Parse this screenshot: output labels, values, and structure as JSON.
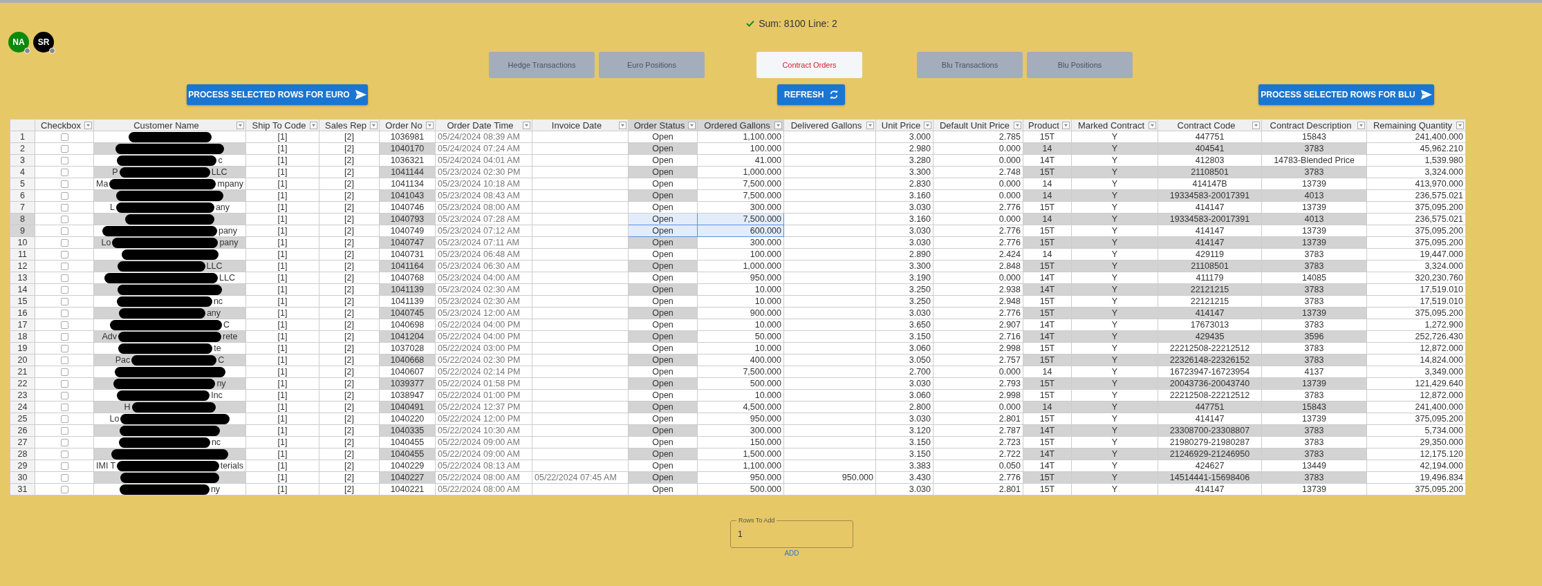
{
  "summary": {
    "text": "Sum: 8100 Line: 2"
  },
  "avatars": [
    {
      "initials": "NA",
      "color": "#0b8a0b"
    },
    {
      "initials": "SR",
      "color": "#000000"
    }
  ],
  "tabs": [
    {
      "label": "Hedge Transactions",
      "selected": false
    },
    {
      "label": "Euro Positions",
      "selected": false
    },
    {
      "label": "Contract Orders",
      "selected": true
    },
    {
      "label": "Blu Transactions",
      "selected": false
    },
    {
      "label": "Blu Positions",
      "selected": false
    }
  ],
  "buttons": [
    {
      "label": "PROCESS SELECTED ROWS FOR EURO",
      "kind": "send"
    },
    {
      "label": "REFRESH",
      "kind": "refresh"
    },
    {
      "label": "PROCESS SELECTED ROWS FOR BLU",
      "kind": "send"
    }
  ],
  "table": {
    "columns": [
      "Checkbox",
      "Customer Name",
      "Ship To Code",
      "Sales Rep",
      "Order No",
      "Order Date Time",
      "Invoice Date",
      "Order Status",
      "Ordered Gallons",
      "Delivered Gallons",
      "Unit Price",
      "Default Unit Price",
      "Product",
      "Marked Contract",
      "Contract Code",
      "Contract Description",
      "Remaining Quantity"
    ],
    "rows": [
      {
        "n": "1",
        "checked": false,
        "selected": false,
        "ship_to_code": "[1]",
        "sales_rep": "[2]",
        "order_no": "1036981",
        "order_date_time": "05/24/2024 08:39 AM",
        "order_status": "Open",
        "ordered_gallons": "1,100.000",
        "unit_price": "3.000",
        "default_unit_price": "2.785",
        "product": "15T",
        "marked_contract": "Y",
        "contract_code": "447751",
        "contract_description": "15843",
        "remaining_quantity": "241,400.000"
      },
      {
        "n": "2",
        "checked": false,
        "selected": false,
        "ship_to_code": "[1]",
        "sales_rep": "[2]",
        "order_no": "1040170",
        "order_date_time": "05/24/2024 07:24 AM",
        "order_status": "Open",
        "ordered_gallons": "100.000",
        "unit_price": "2.980",
        "default_unit_price": "0.000",
        "product": "14",
        "marked_contract": "Y",
        "contract_code": "404541",
        "contract_description": "3783",
        "remaining_quantity": "45,962.210"
      },
      {
        "n": "3",
        "checked": false,
        "selected": false,
        "customer_end": "c",
        "ship_to_code": "[1]",
        "sales_rep": "[2]",
        "order_no": "1036321",
        "order_date_time": "05/24/2024 04:01 AM",
        "order_status": "Open",
        "ordered_gallons": "41.000",
        "unit_price": "3.280",
        "default_unit_price": "0.000",
        "product": "14T",
        "marked_contract": "Y",
        "contract_code": "412803",
        "contract_description": "14783-Blended Price",
        "remaining_quantity": "1,539.980"
      },
      {
        "n": "4",
        "checked": false,
        "selected": false,
        "customer_start": "P",
        "customer_end": "LLC",
        "ship_to_code": "[1]",
        "sales_rep": "[2]",
        "order_no": "1041144",
        "order_date_time": "05/23/2024 02:30 PM",
        "order_status": "Open",
        "ordered_gallons": "1,000.000",
        "unit_price": "3.300",
        "default_unit_price": "2.748",
        "product": "15T",
        "marked_contract": "Y",
        "contract_code": "21108501",
        "contract_description": "3783",
        "remaining_quantity": "3,324.000"
      },
      {
        "n": "5",
        "checked": false,
        "selected": false,
        "customer_start": "Ma",
        "customer_end": "mpany",
        "ship_to_code": "[1]",
        "sales_rep": "[2]",
        "order_no": "1041134",
        "order_date_time": "05/23/2024 10:18 AM",
        "order_status": "Open",
        "ordered_gallons": "7,500.000",
        "unit_price": "2.830",
        "default_unit_price": "0.000",
        "product": "14",
        "marked_contract": "Y",
        "contract_code": "414147B",
        "contract_description": "13739",
        "remaining_quantity": "413,970.000"
      },
      {
        "n": "6",
        "checked": false,
        "selected": false,
        "ship_to_code": "[1]",
        "sales_rep": "[2]",
        "order_no": "1041043",
        "order_date_time": "05/23/2024 08:43 AM",
        "order_status": "Open",
        "ordered_gallons": "7,500.000",
        "unit_price": "3.160",
        "default_unit_price": "0.000",
        "product": "14",
        "marked_contract": "Y",
        "contract_code": "19334583-20017391",
        "contract_description": "4013",
        "remaining_quantity": "236,575.021"
      },
      {
        "n": "7",
        "checked": false,
        "selected": false,
        "customer_start": "L",
        "customer_end": "any",
        "ship_to_code": "[1]",
        "sales_rep": "[2]",
        "order_no": "1040746",
        "order_date_time": "05/23/2024 08:00 AM",
        "order_status": "Open",
        "ordered_gallons": "300.000",
        "unit_price": "3.030",
        "default_unit_price": "2.776",
        "product": "15T",
        "marked_contract": "Y",
        "contract_code": "414147",
        "contract_description": "13739",
        "remaining_quantity": "375,095.200"
      },
      {
        "n": "8",
        "checked": false,
        "selected": true,
        "ship_to_code": "[1]",
        "sales_rep": "[2]",
        "order_no": "1040793",
        "order_date_time": "05/23/2024 07:28 AM",
        "order_status": "Open",
        "ordered_gallons": "7,500.000",
        "unit_price": "3.160",
        "default_unit_price": "0.000",
        "product": "14",
        "marked_contract": "Y",
        "contract_code": "19334583-20017391",
        "contract_description": "4013",
        "remaining_quantity": "236,575.021"
      },
      {
        "n": "9",
        "checked": false,
        "selected": true,
        "customer_end": "pany",
        "ship_to_code": "[1]",
        "sales_rep": "[2]",
        "order_no": "1040749",
        "order_date_time": "05/23/2024 07:12 AM",
        "order_status": "Open",
        "ordered_gallons": "600.000",
        "unit_price": "3.030",
        "default_unit_price": "2.776",
        "product": "15T",
        "marked_contract": "Y",
        "contract_code": "414147",
        "contract_description": "13739",
        "remaining_quantity": "375,095.200"
      },
      {
        "n": "10",
        "checked": false,
        "selected": false,
        "customer_start": "Lo",
        "customer_end": "pany",
        "ship_to_code": "[1]",
        "sales_rep": "[2]",
        "order_no": "1040747",
        "order_date_time": "05/23/2024 07:11 AM",
        "order_status": "Open",
        "ordered_gallons": "300.000",
        "unit_price": "3.030",
        "default_unit_price": "2.776",
        "product": "15T",
        "marked_contract": "Y",
        "contract_code": "414147",
        "contract_description": "13739",
        "remaining_quantity": "375,095.200"
      },
      {
        "n": "11",
        "checked": false,
        "selected": false,
        "ship_to_code": "[1]",
        "sales_rep": "[2]",
        "order_no": "1040731",
        "order_date_time": "05/23/2024 06:48 AM",
        "order_status": "Open",
        "ordered_gallons": "100.000",
        "unit_price": "2.890",
        "default_unit_price": "2.424",
        "product": "14",
        "marked_contract": "Y",
        "contract_code": "429119",
        "contract_description": "3783",
        "remaining_quantity": "19,447.000"
      },
      {
        "n": "12",
        "checked": false,
        "selected": false,
        "customer_end": "LLC",
        "ship_to_code": "[1]",
        "sales_rep": "[2]",
        "order_no": "1041164",
        "order_date_time": "05/23/2024 06:30 AM",
        "order_status": "Open",
        "ordered_gallons": "1,000.000",
        "unit_price": "3.300",
        "default_unit_price": "2.848",
        "product": "15T",
        "marked_contract": "Y",
        "contract_code": "21108501",
        "contract_description": "3783",
        "remaining_quantity": "3,324.000"
      },
      {
        "n": "13",
        "checked": false,
        "selected": false,
        "customer_end": "LLC",
        "ship_to_code": "[1]",
        "sales_rep": "[2]",
        "order_no": "1040768",
        "order_date_time": "05/23/2024 04:00 AM",
        "order_status": "Open",
        "ordered_gallons": "950.000",
        "unit_price": "3.190",
        "default_unit_price": "0.000",
        "product": "14T",
        "marked_contract": "Y",
        "contract_code": "411179",
        "contract_description": "14085",
        "remaining_quantity": "320,230.760"
      },
      {
        "n": "14",
        "checked": false,
        "selected": false,
        "ship_to_code": "[1]",
        "sales_rep": "[2]",
        "order_no": "1041139",
        "order_date_time": "05/23/2024 02:30 AM",
        "order_status": "Open",
        "ordered_gallons": "10.000",
        "unit_price": "3.250",
        "default_unit_price": "2.938",
        "product": "14T",
        "marked_contract": "Y",
        "contract_code": "22121215",
        "contract_description": "3783",
        "remaining_quantity": "17,519.010"
      },
      {
        "n": "15",
        "checked": false,
        "selected": false,
        "customer_end": "nc",
        "ship_to_code": "[1]",
        "sales_rep": "[2]",
        "order_no": "1041139",
        "order_date_time": "05/23/2024 02:30 AM",
        "order_status": "Open",
        "ordered_gallons": "10.000",
        "unit_price": "3.250",
        "default_unit_price": "2.948",
        "product": "15T",
        "marked_contract": "Y",
        "contract_code": "22121215",
        "contract_description": "3783",
        "remaining_quantity": "17,519.010"
      },
      {
        "n": "16",
        "checked": false,
        "selected": false,
        "customer_end": "any",
        "ship_to_code": "[1]",
        "sales_rep": "[2]",
        "order_no": "1040745",
        "order_date_time": "05/23/2024 12:00 AM",
        "order_status": "Open",
        "ordered_gallons": "900.000",
        "unit_price": "3.030",
        "default_unit_price": "2.776",
        "product": "15T",
        "marked_contract": "Y",
        "contract_code": "414147",
        "contract_description": "13739",
        "remaining_quantity": "375,095.200"
      },
      {
        "n": "17",
        "checked": false,
        "selected": false,
        "customer_end": "C",
        "ship_to_code": "[1]",
        "sales_rep": "[2]",
        "order_no": "1040698",
        "order_date_time": "05/22/2024 04:00 PM",
        "order_status": "Open",
        "ordered_gallons": "10.000",
        "unit_price": "3.650",
        "default_unit_price": "2.907",
        "product": "14T",
        "marked_contract": "Y",
        "contract_code": "17673013",
        "contract_description": "3783",
        "remaining_quantity": "1,272.900"
      },
      {
        "n": "18",
        "checked": false,
        "selected": false,
        "customer_start": "Adv",
        "customer_end": "rete",
        "ship_to_code": "[1]",
        "sales_rep": "[2]",
        "order_no": "1041204",
        "order_date_time": "05/22/2024 04:00 PM",
        "order_status": "Open",
        "ordered_gallons": "50.000",
        "unit_price": "3.150",
        "default_unit_price": "2.716",
        "product": "14T",
        "marked_contract": "Y",
        "contract_code": "429435",
        "contract_description": "3596",
        "remaining_quantity": "252,726.430"
      },
      {
        "n": "19",
        "checked": false,
        "selected": false,
        "customer_end": "te",
        "ship_to_code": "[1]",
        "sales_rep": "[2]",
        "order_no": "1037028",
        "order_date_time": "05/22/2024 03:00 PM",
        "order_status": "Open",
        "ordered_gallons": "10.000",
        "unit_price": "3.060",
        "default_unit_price": "2.998",
        "product": "15T",
        "marked_contract": "Y",
        "contract_code": "22212508-22212512",
        "contract_description": "3783",
        "remaining_quantity": "12,872.000"
      },
      {
        "n": "20",
        "checked": false,
        "selected": false,
        "customer_start": "Pac",
        "customer_end": "C",
        "ship_to_code": "[1]",
        "sales_rep": "[2]",
        "order_no": "1040668",
        "order_date_time": "05/22/2024 02:30 PM",
        "order_status": "Open",
        "ordered_gallons": "400.000",
        "unit_price": "3.050",
        "default_unit_price": "2.757",
        "product": "15T",
        "marked_contract": "Y",
        "contract_code": "22326148-22326152",
        "contract_description": "3783",
        "remaining_quantity": "14,824.000"
      },
      {
        "n": "21",
        "checked": false,
        "selected": false,
        "ship_to_code": "[1]",
        "sales_rep": "[2]",
        "order_no": "1040607",
        "order_date_time": "05/22/2024 02:14 PM",
        "order_status": "Open",
        "ordered_gallons": "7,500.000",
        "unit_price": "2.700",
        "default_unit_price": "0.000",
        "product": "14",
        "marked_contract": "Y",
        "contract_code": "16723947-16723954",
        "contract_description": "4137",
        "remaining_quantity": "3,349.000"
      },
      {
        "n": "22",
        "checked": false,
        "selected": false,
        "customer_end": "ny",
        "ship_to_code": "[1]",
        "sales_rep": "[2]",
        "order_no": "1039377",
        "order_date_time": "05/22/2024 01:58 PM",
        "order_status": "Open",
        "ordered_gallons": "500.000",
        "unit_price": "3.030",
        "default_unit_price": "2.793",
        "product": "15T",
        "marked_contract": "Y",
        "contract_code": "20043736-20043740",
        "contract_description": "13739",
        "remaining_quantity": "121,429.640"
      },
      {
        "n": "23",
        "checked": false,
        "selected": false,
        "customer_end": "Inc",
        "ship_to_code": "[1]",
        "sales_rep": "[2]",
        "order_no": "1038947",
        "order_date_time": "05/22/2024 01:00 PM",
        "order_status": "Open",
        "ordered_gallons": "10.000",
        "unit_price": "3.060",
        "default_unit_price": "2.998",
        "product": "15T",
        "marked_contract": "Y",
        "contract_code": "22212508-22212512",
        "contract_description": "3783",
        "remaining_quantity": "12,872.000"
      },
      {
        "n": "24",
        "checked": false,
        "selected": false,
        "customer_start": "H",
        "ship_to_code": "[1]",
        "sales_rep": "[2]",
        "order_no": "1040491",
        "order_date_time": "05/22/2024 12:37 PM",
        "order_status": "Open",
        "ordered_gallons": "4,500.000",
        "unit_price": "2.800",
        "default_unit_price": "0.000",
        "product": "14",
        "marked_contract": "Y",
        "contract_code": "447751",
        "contract_description": "15843",
        "remaining_quantity": "241,400.000"
      },
      {
        "n": "25",
        "checked": false,
        "selected": false,
        "customer_start": "Lo",
        "ship_to_code": "[1]",
        "sales_rep": "[2]",
        "order_no": "1040220",
        "order_date_time": "05/22/2024 12:00 PM",
        "order_status": "Open",
        "ordered_gallons": "950.000",
        "unit_price": "3.030",
        "default_unit_price": "2.801",
        "product": "15T",
        "marked_contract": "Y",
        "contract_code": "414147",
        "contract_description": "13739",
        "remaining_quantity": "375,095.200"
      },
      {
        "n": "26",
        "checked": false,
        "selected": false,
        "ship_to_code": "[1]",
        "sales_rep": "[2]",
        "order_no": "1040335",
        "order_date_time": "05/22/2024 10:30 AM",
        "order_status": "Open",
        "ordered_gallons": "300.000",
        "unit_price": "3.120",
        "default_unit_price": "2.787",
        "product": "14T",
        "marked_contract": "Y",
        "contract_code": "23308700-23308807",
        "contract_description": "3783",
        "remaining_quantity": "5,734.000"
      },
      {
        "n": "27",
        "checked": false,
        "selected": false,
        "customer_end": "nc",
        "ship_to_code": "[1]",
        "sales_rep": "[2]",
        "order_no": "1040455",
        "order_date_time": "05/22/2024 09:00 AM",
        "order_status": "Open",
        "ordered_gallons": "150.000",
        "unit_price": "3.150",
        "default_unit_price": "2.723",
        "product": "15T",
        "marked_contract": "Y",
        "contract_code": "21980279-21980287",
        "contract_description": "3783",
        "remaining_quantity": "29,350.000"
      },
      {
        "n": "28",
        "checked": false,
        "selected": false,
        "ship_to_code": "[1]",
        "sales_rep": "[2]",
        "order_no": "1040455",
        "order_date_time": "05/22/2024 09:00 AM",
        "order_status": "Open",
        "ordered_gallons": "1,500.000",
        "unit_price": "3.150",
        "default_unit_price": "2.722",
        "product": "14T",
        "marked_contract": "Y",
        "contract_code": "21246929-21246950",
        "contract_description": "3783",
        "remaining_quantity": "12,175.120"
      },
      {
        "n": "29",
        "checked": false,
        "selected": false,
        "customer_start": "IMI T",
        "customer_end": "terials",
        "ship_to_code": "[1]",
        "sales_rep": "[2]",
        "order_no": "1040229",
        "order_date_time": "05/22/2024 08:13 AM",
        "order_status": "Open",
        "ordered_gallons": "1,100.000",
        "unit_price": "3.383",
        "default_unit_price": "0.050",
        "product": "14T",
        "marked_contract": "Y",
        "contract_code": "424627",
        "contract_description": "13449",
        "remaining_quantity": "42,194.000"
      },
      {
        "n": "30",
        "checked": false,
        "selected": false,
        "ship_to_code": "[1]",
        "sales_rep": "[2]",
        "order_no": "1040227",
        "order_date_time": "05/22/2024 08:00 AM",
        "invoice_date": "05/22/2024 07:45 AM",
        "order_status": "Open",
        "ordered_gallons": "950.000",
        "delivered_gallons": "950.000",
        "unit_price": "3.430",
        "default_unit_price": "2.776",
        "product": "15T",
        "marked_contract": "Y",
        "contract_code": "14514441-15698406",
        "contract_description": "3783",
        "remaining_quantity": "19,496.834"
      },
      {
        "n": "31",
        "checked": false,
        "selected": false,
        "customer_end": "ny",
        "ship_to_code": "[1]",
        "sales_rep": "[2]",
        "order_no": "1040221",
        "order_date_time": "05/22/2024 08:00 AM",
        "order_status": "Open",
        "ordered_gallons": "500.000",
        "unit_price": "3.030",
        "default_unit_price": "2.801",
        "product": "15T",
        "marked_contract": "Y",
        "contract_code": "414147",
        "contract_description": "13739",
        "remaining_quantity": "375,095.200"
      }
    ]
  },
  "rows_to_add": {
    "label": "Rows To Add",
    "value": "1"
  },
  "add_link": {
    "label": "ADD"
  }
}
